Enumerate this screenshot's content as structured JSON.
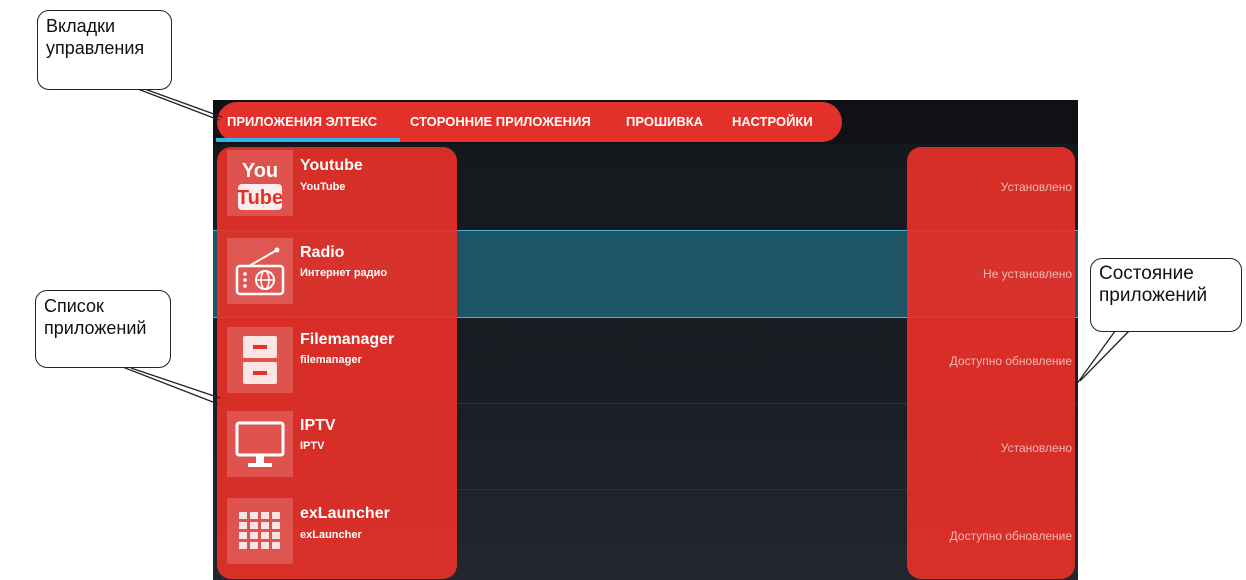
{
  "tabs": [
    {
      "label": "ПРИЛОЖЕНИЯ ЭЛТЕКС"
    },
    {
      "label": "СТОРОННИЕ ПРИЛОЖЕНИЯ"
    },
    {
      "label": "ПРОШИВКА"
    },
    {
      "label": "НАСТРОЙКИ"
    }
  ],
  "apps": [
    {
      "name": "Youtube",
      "subtitle": "YouTube",
      "status": "Установлено",
      "icon": "youtube-icon"
    },
    {
      "name": "Radio",
      "subtitle": "Интернет радио",
      "status": "Не установлено",
      "icon": "radio-icon"
    },
    {
      "name": "Filemanager",
      "subtitle": "filemanager",
      "status": "Доступно обновление",
      "icon": "file-cabinet-icon"
    },
    {
      "name": "IPTV",
      "subtitle": "IPTV",
      "status": "Установлено",
      "icon": "tv-icon"
    },
    {
      "name": "exLauncher",
      "subtitle": "exLauncher",
      "status": "Доступно обновление",
      "icon": "app-grid-icon"
    }
  ],
  "youtube_logo": {
    "top": "You",
    "bottom": "Tube"
  },
  "callouts": {
    "tabs": {
      "line1": "Вкладки",
      "line2": "управления"
    },
    "list": {
      "line1": "Список",
      "line2": "приложений"
    },
    "state": {
      "line1": "Состояние",
      "line2": "приложений"
    }
  },
  "colors": {
    "highlight": "#e4302a",
    "accent": "#33b5e5",
    "selected_row": "#1d5566"
  }
}
